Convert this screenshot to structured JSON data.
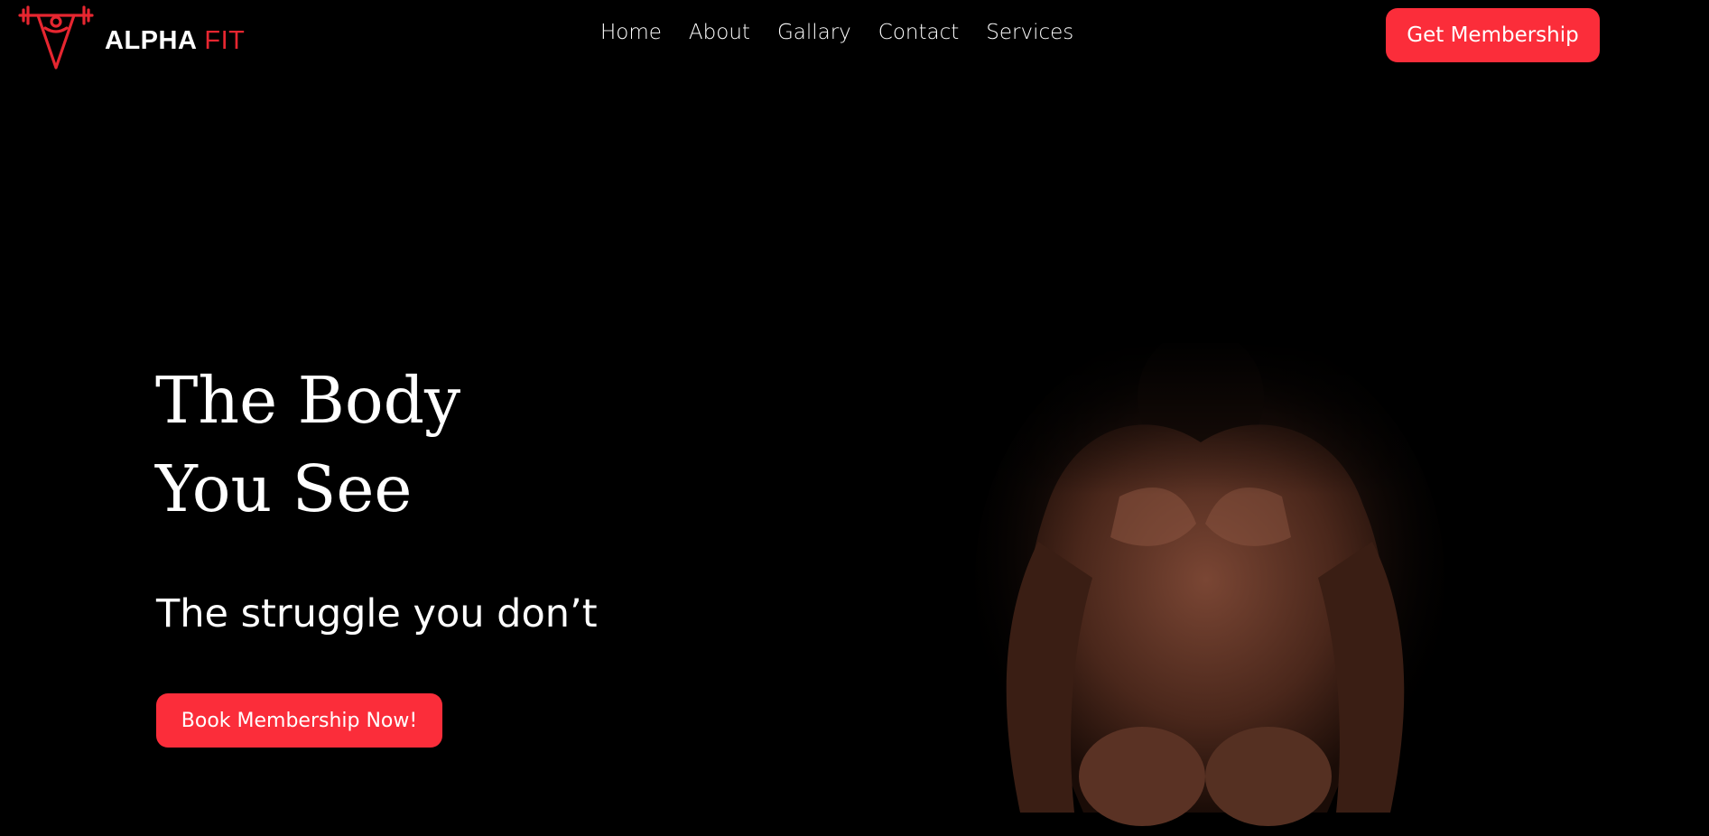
{
  "brand": {
    "name": "ALPHA",
    "accent": "FIT",
    "logo_icon": "barbell-trophy-icon",
    "accent_color": "#e62630"
  },
  "nav": {
    "items": [
      {
        "label": "Home"
      },
      {
        "label": "About"
      },
      {
        "label": "Gallary"
      },
      {
        "label": "Contact"
      },
      {
        "label": "Services"
      }
    ],
    "cta_label": "Get Membership"
  },
  "hero": {
    "title_line1": "The Body",
    "title_line2": "You See",
    "subtitle": "The struggle you don’t",
    "cta_label": "Book Membership Now!",
    "image_icon": "athlete-photo"
  },
  "colors": {
    "background": "#000000",
    "button": "#fb2d3a",
    "text": "#ffffff"
  }
}
